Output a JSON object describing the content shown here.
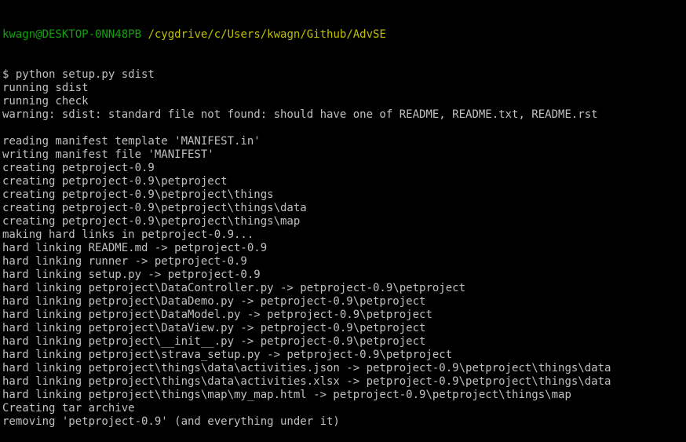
{
  "prompt": {
    "user_host": "kwagn@DESKTOP-0NN48PB",
    "path": "/cygdrive/c/Users/kwagn/Github/AdvSE"
  },
  "output_lines": [
    "$ python setup.py sdist",
    "running sdist",
    "running check",
    "warning: sdist: standard file not found: should have one of README, README.txt, README.rst",
    "",
    "reading manifest template 'MANIFEST.in'",
    "writing manifest file 'MANIFEST'",
    "creating petproject-0.9",
    "creating petproject-0.9\\petproject",
    "creating petproject-0.9\\petproject\\things",
    "creating petproject-0.9\\petproject\\things\\data",
    "creating petproject-0.9\\petproject\\things\\map",
    "making hard links in petproject-0.9...",
    "hard linking README.md -> petproject-0.9",
    "hard linking runner -> petproject-0.9",
    "hard linking setup.py -> petproject-0.9",
    "hard linking petproject\\DataController.py -> petproject-0.9\\petproject",
    "hard linking petproject\\DataDemo.py -> petproject-0.9\\petproject",
    "hard linking petproject\\DataModel.py -> petproject-0.9\\petproject",
    "hard linking petproject\\DataView.py -> petproject-0.9\\petproject",
    "hard linking petproject\\__init__.py -> petproject-0.9\\petproject",
    "hard linking petproject\\strava_setup.py -> petproject-0.9\\petproject",
    "hard linking petproject\\things\\data\\activities.json -> petproject-0.9\\petproject\\things\\data",
    "hard linking petproject\\things\\data\\activities.xlsx -> petproject-0.9\\petproject\\things\\data",
    "hard linking petproject\\things\\map\\my_map.html -> petproject-0.9\\petproject\\things\\map",
    "Creating tar archive",
    "removing 'petproject-0.9' (and everything under it)"
  ],
  "colors": {
    "background": "#000000",
    "text": "#c0c0c0",
    "prompt_user": "#13a10e",
    "prompt_path": "#c1c100"
  }
}
